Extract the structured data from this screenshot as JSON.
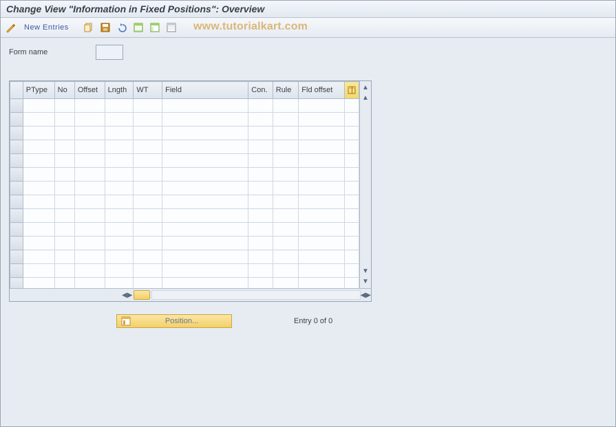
{
  "title": "Change View \"Information in Fixed Positions\": Overview",
  "toolbar": {
    "new_entries": "New Entries"
  },
  "watermark": "www.tutorialkart.com",
  "form": {
    "name_label": "Form name",
    "name_value": ""
  },
  "table": {
    "columns": [
      "PType",
      "No",
      "Offset",
      "Lngth",
      "WT",
      "Field",
      "Con.",
      "Rule",
      "Fld offset"
    ],
    "row_count": 15
  },
  "footer": {
    "position_label": "Position...",
    "entry_text": "Entry 0 of 0"
  },
  "icons": {
    "toggle": "toggle-icon",
    "copy": "copy-icon",
    "save": "save-icon",
    "undo": "undo-icon",
    "select_all": "select-all-icon",
    "deselect_all": "deselect-all-icon",
    "delete": "delete-icon"
  }
}
